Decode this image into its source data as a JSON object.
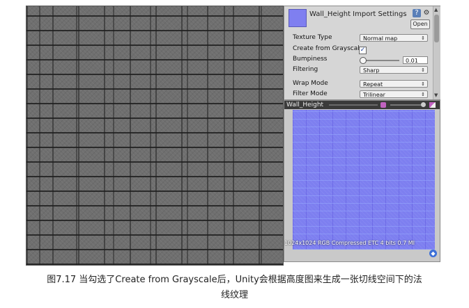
{
  "inspector": {
    "title": "Wall_Height Import Settings",
    "open_label": "Open",
    "help_icon": "help-icon",
    "gear_icon": "gear-icon",
    "texture_type_label": "Texture Type",
    "texture_type_value": "Normal map",
    "create_from_grayscale_label": "Create from Grayscale",
    "create_from_grayscale_checked": true,
    "bumpiness_label": "Bumpiness",
    "bumpiness_value": "0.01",
    "filtering_label": "Filtering",
    "filtering_value": "Sharp",
    "wrap_mode_label": "Wrap Mode",
    "wrap_mode_value": "Repeat",
    "filter_mode_label": "Filter Mode",
    "filter_mode_value": "Trilinear"
  },
  "preview": {
    "title": "Wall_Height",
    "info": "1024x1024  RGB Compressed ETC 4 bits   0.7 MI"
  },
  "colors": {
    "normal_map": "#7d7ff0",
    "heightmap": "#6f6f6f",
    "inspector_bg": "#d6d6d6"
  },
  "caption": {
    "line1": "图7.17 当勾选了Create from Grayscale后，Unity会根据高度图来生成一张切线空间下的法",
    "line2": "线纹理"
  }
}
